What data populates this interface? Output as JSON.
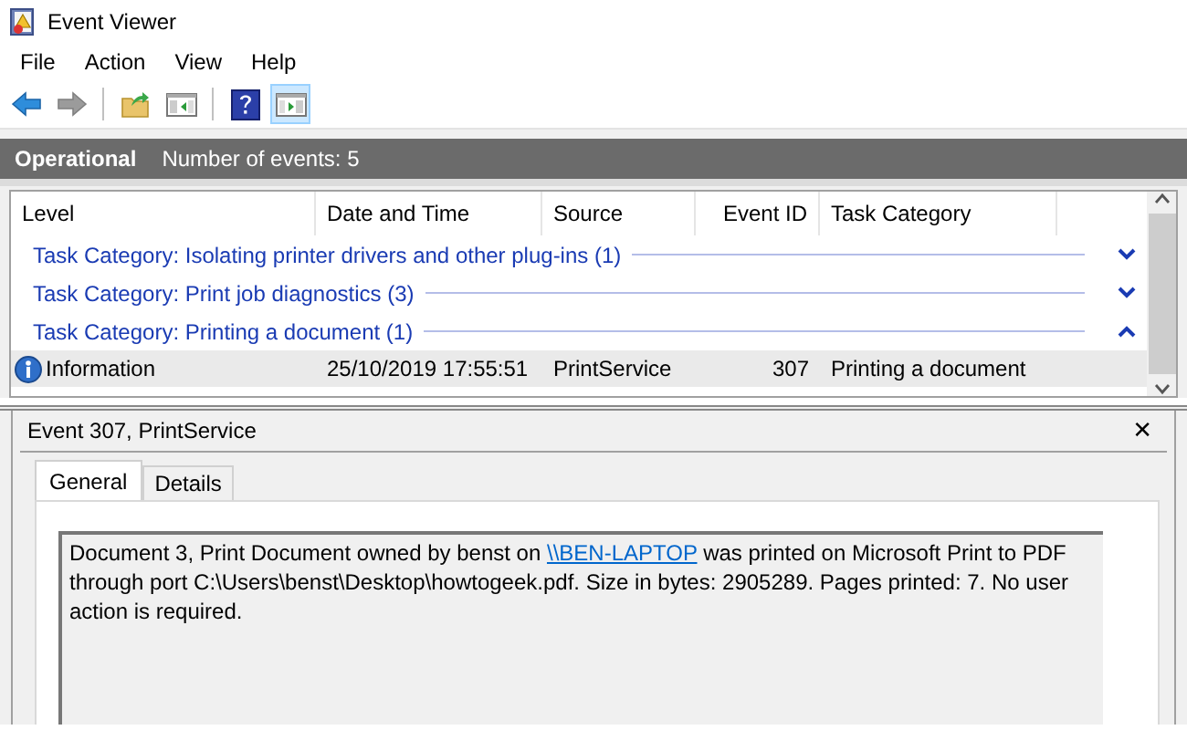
{
  "window": {
    "title": "Event Viewer"
  },
  "menu": [
    "File",
    "Action",
    "View",
    "Help"
  ],
  "toolbar": [
    {
      "kind": "back",
      "disabled": false,
      "pressed": false
    },
    {
      "kind": "forward",
      "disabled": true,
      "pressed": false
    },
    {
      "kind": "separator"
    },
    {
      "kind": "folder",
      "disabled": false,
      "pressed": false
    },
    {
      "kind": "panel-left",
      "disabled": false,
      "pressed": false
    },
    {
      "kind": "separator"
    },
    {
      "kind": "help",
      "disabled": false,
      "pressed": false
    },
    {
      "kind": "panel-right",
      "disabled": false,
      "pressed": true
    }
  ],
  "log_header": {
    "title": "Operational",
    "count": "Number of events: 5"
  },
  "table": {
    "columns": [
      "Level",
      "Date and Time",
      "Source",
      "Event ID",
      "Task Category"
    ],
    "groups": [
      {
        "label": "Task Category: Isolating printer drivers and other plug-ins (1)",
        "expanded": false
      },
      {
        "label": "Task Category: Print job diagnostics (3)",
        "expanded": false
      },
      {
        "label": "Task Category: Printing a document (1)",
        "expanded": true,
        "rows": [
          {
            "level": "Information",
            "date": "25/10/2019 17:55:51",
            "source": "PrintService",
            "event_id": "307",
            "task_category": "Printing a document",
            "selected": true
          }
        ]
      }
    ]
  },
  "details": {
    "title": "Event 307, PrintService",
    "close": "✕",
    "tabs": [
      {
        "label": "General",
        "selected": true
      },
      {
        "label": "Details",
        "selected": false
      }
    ],
    "description": {
      "before": "Document 3, Print Document owned by benst on ",
      "link": "\\\\BEN-LAPTOP",
      "after": " was printed on Microsoft Print to PDF through port C:\\Users\\benst\\Desktop\\howtogeek.pdf. Size in bytes: 2905289. Pages printed: 7. No user action is required."
    }
  }
}
